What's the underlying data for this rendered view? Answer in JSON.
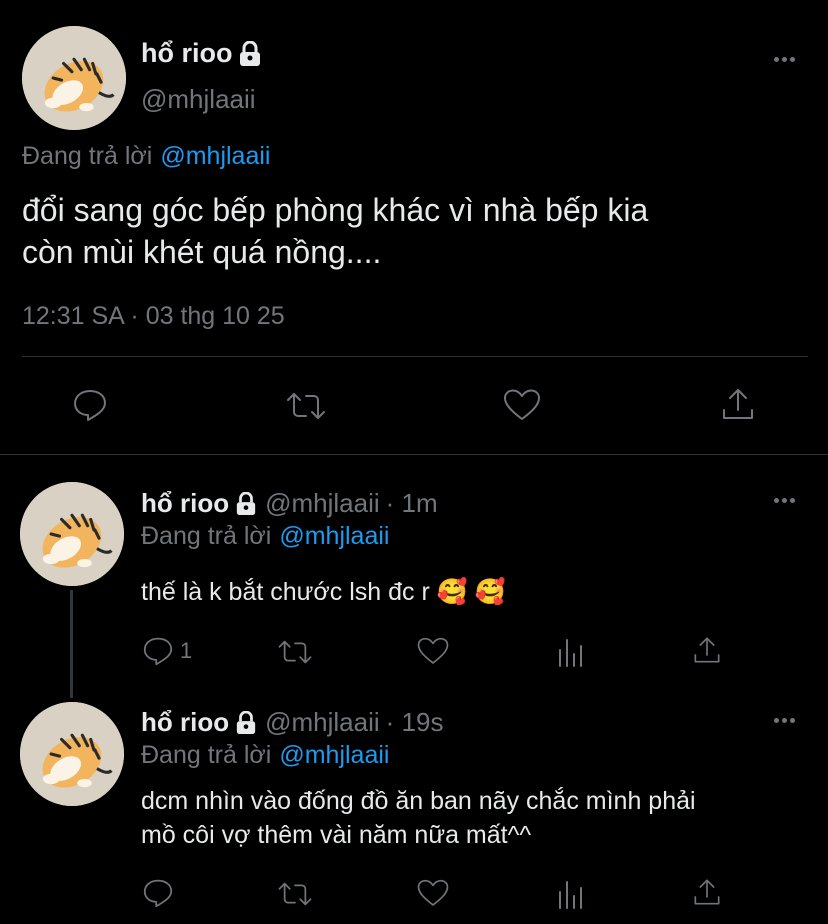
{
  "main_tweet": {
    "display_name": "hổ rioo",
    "handle": "@mhjlaaii",
    "replying_prefix": "Đang trả lời",
    "replying_to": "@mhjlaaii",
    "text_line1": "đổi sang góc bếp phòng khác vì nhà bếp kia",
    "text_line2": "còn mùi khét quá nồng....",
    "timestamp": "12:31 SA · 03 thg 10 25"
  },
  "replies": [
    {
      "display_name": "hổ rioo",
      "handle": "@mhjlaaii",
      "time": "· 1m",
      "replying_prefix": "Đang trả lời",
      "replying_to": "@mhjlaaii",
      "text_line1": "thế là k bắt chước lsh đc r 🥰 🥰",
      "reply_count": "1"
    },
    {
      "display_name": "hổ rioo",
      "handle": "@mhjlaaii",
      "time": "· 19s",
      "replying_prefix": "Đang trả lời",
      "replying_to": "@mhjlaaii",
      "text_line1": "dcm nhìn vào đống đồ ăn ban nãy chắc mình phải",
      "text_line2": "mồ côi vợ thêm vài năm nữa mất^^",
      "reply_count": ""
    }
  ],
  "icons": {
    "reply": "reply-icon",
    "retweet": "retweet-icon",
    "like": "like-icon",
    "share": "share-icon",
    "views": "views-icon",
    "more": "more-icon",
    "lock": "lock-icon",
    "avatar": "tiger-avatar"
  },
  "colors": {
    "background": "#000000",
    "text": "#e7e9ea",
    "muted": "#71767b",
    "link": "#1d9bf0",
    "divider": "#2f3336"
  }
}
